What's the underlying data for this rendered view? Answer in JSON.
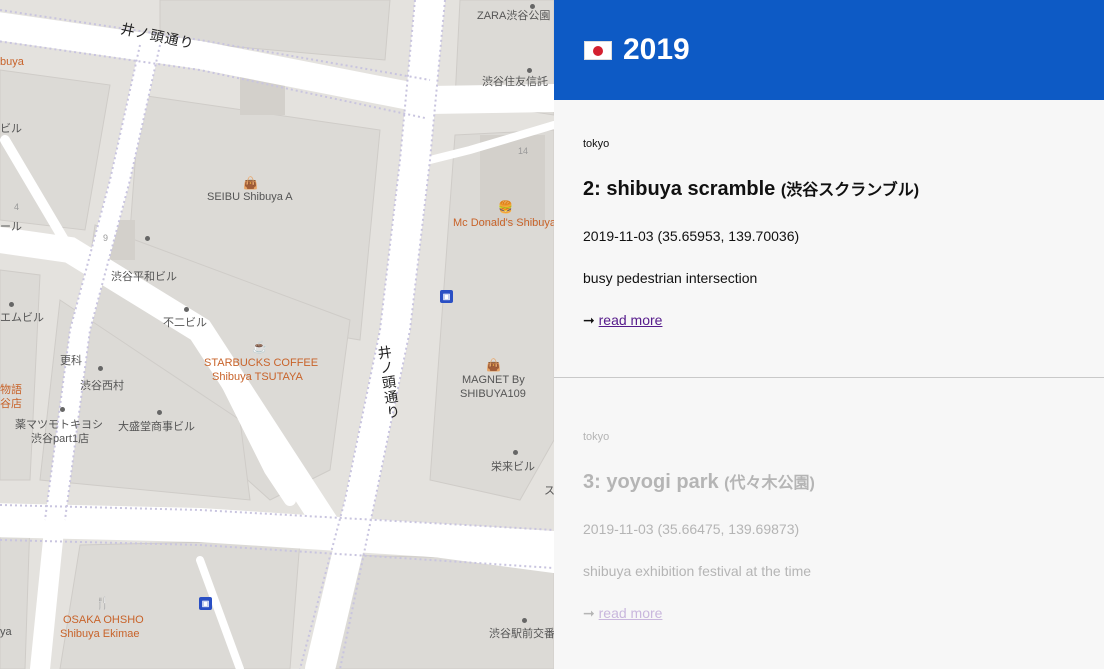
{
  "map": {
    "roads": {
      "inokashira_top": "井ノ頭通り",
      "inokashira_mid": "井ノ頭通り"
    },
    "labels": {
      "zara": "ZARA渋谷公園",
      "sumitomo": "渋谷住友信託",
      "buya": "buya",
      "biru_left": "ビル",
      "seibu": "SEIBU Shibuya A",
      "block14": "14",
      "mcdonalds": "Mc Donald's Shibuya",
      "nine": "9",
      "four": "4",
      "ru_left": "ール",
      "heiwa": "渋谷平和ビル",
      "fuji": "不二ビル",
      "emubiru": "エムビル",
      "sarashina": "更科",
      "starbucks_1": "STARBUCKS COFFEE",
      "starbucks_2": "Shibuya TSUTAYA",
      "monogatari_1": "物語",
      "monogatari_2": "谷店",
      "nishimura": "渋谷西村",
      "magnet_1": "MAGNET By",
      "magnet_2": "SHIBUYA109",
      "matsumoto_1": "薬マツモトキヨシ",
      "matsumoto_2": "渋谷part1店",
      "taisei": "大盛堂商事ビル",
      "eirai": "栄来ビル",
      "su": "ス",
      "osaka_1": "OSAKA OHSHO",
      "osaka_2": "Shibuya Ekimae",
      "ya": "ya",
      "ekimae": "渋谷駅前交番"
    },
    "icons": {
      "shop": "shopping-bag-icon",
      "food": "burger-icon",
      "cafe": "coffee-cup-icon",
      "restaurant": "fork-knife-icon",
      "bus": "bus-stop-icon"
    }
  },
  "panel": {
    "header": {
      "flag": "japan-flag-icon",
      "year": "2019"
    },
    "entries": [
      {
        "city": "tokyo",
        "title": "2: shibuya scramble",
        "title_jp": "(渋谷スクランブル)",
        "meta": "2019-11-03 (35.65953, 139.70036)",
        "description": "busy pedestrian intersection",
        "arrow": "➞",
        "link": "read more"
      },
      {
        "city": "tokyo",
        "title": "3: yoyogi park",
        "title_jp": "(代々木公園)",
        "meta": "2019-11-03 (35.66475, 139.69873)",
        "description": "shibuya exhibition festival at the time",
        "arrow": "➞",
        "link": "read more"
      }
    ]
  },
  "colors": {
    "header_bg": "#0d5ac5",
    "panel_bg": "#f7f7f7",
    "link": "#551a8b",
    "poi": "#c8632a"
  }
}
